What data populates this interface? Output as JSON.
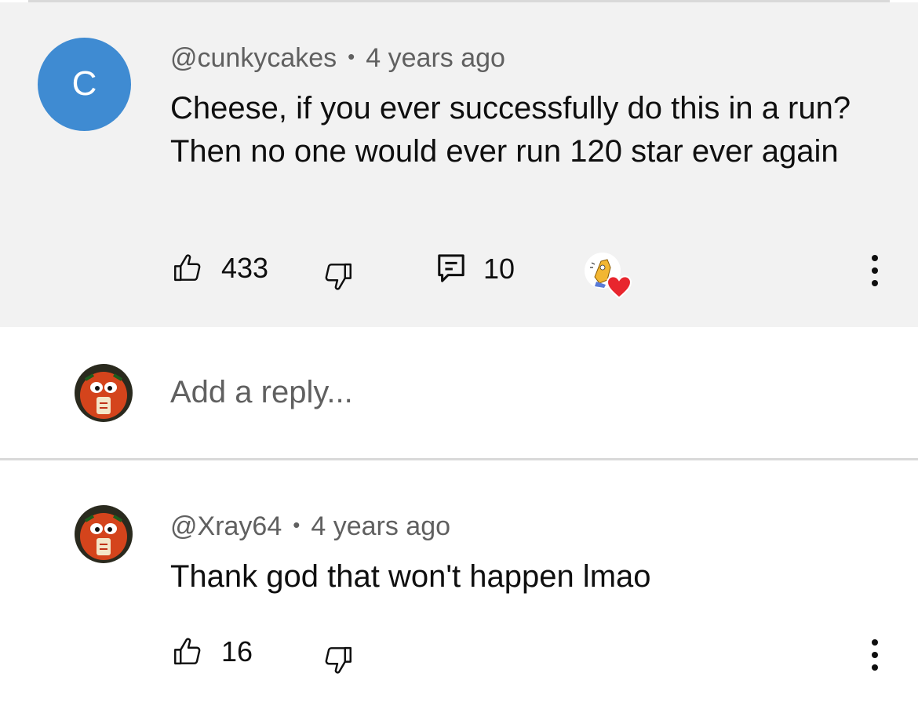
{
  "comment": {
    "avatar_letter": "C",
    "author": "@cunkycakes",
    "separator": "•",
    "time": "4 years ago",
    "text": "Cheese, if you ever successfully do this in a run? Then no one would ever run 120 star ever again",
    "likes": "433",
    "replies": "10",
    "creator_heart": true
  },
  "reply_box": {
    "placeholder": "Add a reply..."
  },
  "reply": {
    "author": "@Xray64",
    "separator": "•",
    "time": "4 years ago",
    "text": "Thank god that won't happen lmao",
    "likes": "16"
  },
  "colors": {
    "highlight_bg": "#f2f2f2",
    "avatar_blue": "#3f8bd2",
    "heart_red": "#e8262e",
    "secondary_text": "#606060"
  }
}
